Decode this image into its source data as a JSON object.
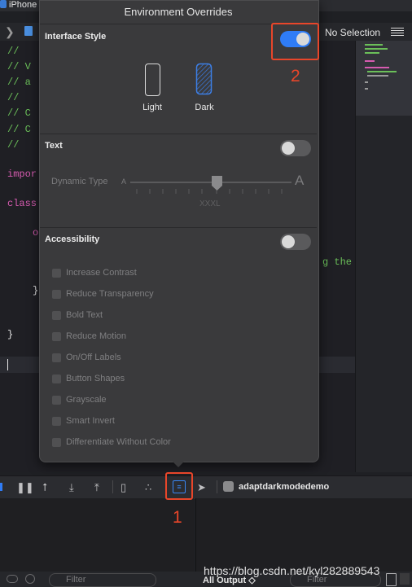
{
  "window": {
    "tab_title": "iPhone",
    "jump_bar_right": "No Selection"
  },
  "editor": {
    "code_fragments": [
      "//",
      "//  V",
      "//  a",
      "//",
      "//  C",
      "//  C",
      "//",
      "impor",
      "class",
      "o",
      "}",
      "}",
      "g the"
    ]
  },
  "popover": {
    "title": "Environment Overrides",
    "interface_style": {
      "title": "Interface Style",
      "enabled": true,
      "options": [
        {
          "label": "Light",
          "selected": false
        },
        {
          "label": "Dark",
          "selected": true
        }
      ]
    },
    "text": {
      "title": "Text",
      "enabled": false,
      "dynamic_type_label": "Dynamic Type",
      "small_a": "A",
      "large_a": "A",
      "current_size": "XXXL"
    },
    "accessibility": {
      "title": "Accessibility",
      "enabled": false,
      "options": [
        "Increase Contrast",
        "Reduce Transparency",
        "Bold Text",
        "Reduce Motion",
        "On/Off Labels",
        "Button Shapes",
        "Grayscale",
        "Smart Invert",
        "Differentiate Without Color"
      ]
    }
  },
  "debug_bar": {
    "target": "adaptdarkmodedemo"
  },
  "console": {
    "left_filter_placeholder": "Filter",
    "output_selector": "All Output ◇",
    "right_filter_placeholder": "Filter"
  },
  "annotations": {
    "marker_1": "1",
    "marker_2": "2",
    "color": "#e8462a"
  },
  "watermark": "https://blog.csdn.net/kyl282889543",
  "colors": {
    "toggle_on": "#2f7cf6",
    "code_comment": "#6bbf59",
    "code_keyword": "#d65bb0"
  }
}
